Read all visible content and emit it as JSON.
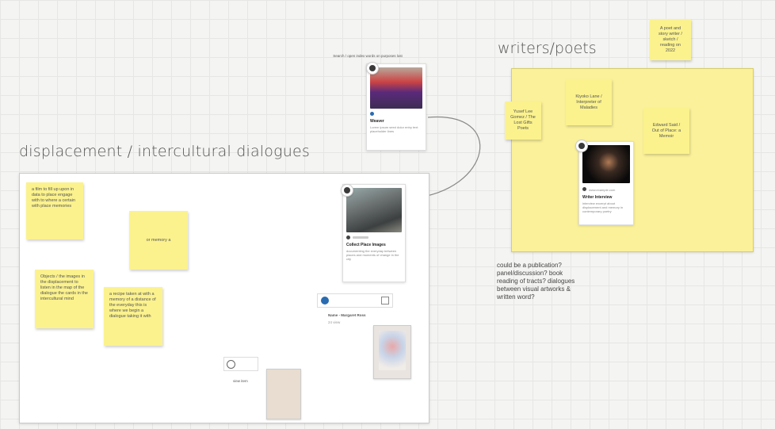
{
  "headings": {
    "displacement": "displacement / intercultural dialogues",
    "writers": "writers/poets"
  },
  "top_card": {
    "caption": "Search / open index words on purposes lost",
    "title": "Weaver",
    "desc": "Lorem ipsum seed dolor entry text placeholder lines"
  },
  "writers_stickies": {
    "s1": "Yusef Lee Gomez / The Lost Gifts Poets",
    "s2": "Kiyoko Lane / Interpreter of Maladies",
    "s3": "Edward Said / Out of Place: a Memoir",
    "corner": "A poet and story writer / sketch / reading on 2022"
  },
  "writers_card": {
    "source": "www.example.com",
    "title": "Writer Interview",
    "desc": "interview excerpt about displacement and memory in contemporary poetry"
  },
  "question_note": "could be a publication? panel/discussion? book reading of tracts? dialogues between visual artworks & written word?",
  "displacement_stickies": {
    "s1": "a film to fill up upon in data to place engage with to where a certain with place memories",
    "s2": "or memory a",
    "s3": "Objects / the images in the displacement to listen in the map of the dialogue the cards in the intercultural mind",
    "s4": "a recipe taken at with a memory of a distance of the everyday this is where we begin a dialogue taking it with"
  },
  "displacement_card": {
    "title": "Collect Place Images",
    "desc": "documenting the everyday between places and moments of change in the city"
  },
  "doc_item": {
    "label": "Name - Margaret Ross",
    "sub": "24 view"
  },
  "file_item": {
    "label": "view item"
  },
  "colors": {
    "sticky": "#fbf28e",
    "frame_yellow": "#fbf19a",
    "grid": "#e6e6e4"
  }
}
